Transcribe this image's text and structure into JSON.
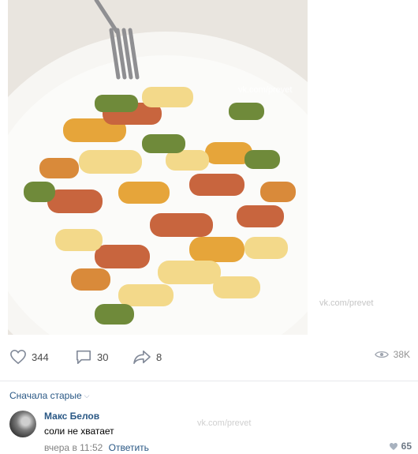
{
  "post": {
    "watermark": "vk.com/prevet",
    "watermark2": "vk.com/prevet"
  },
  "actions": {
    "likes": "344",
    "comments": "30",
    "shares": "8",
    "views": "38K"
  },
  "comments_sort": {
    "label": "Сначала старые"
  },
  "comment": {
    "author": "Макс Белов",
    "text": "соли не хватает",
    "time": "вчера в 11:52",
    "reply_label": "Ответить",
    "likes": "65",
    "watermark": "vk.com/prevet"
  },
  "icons": {
    "like": "heart-outline-icon",
    "comment": "comment-bubble-icon",
    "share": "share-arrow-icon",
    "views": "eye-icon",
    "comment_like": "heart-filled-icon",
    "sort": "chevron-down-icon"
  },
  "colors": {
    "link": "#2a5885",
    "muted": "#828282",
    "pasta_yellow": "#f3d98a",
    "pasta_orange": "#e6a53a",
    "pasta_red": "#c8653e",
    "pasta_green": "#6f8a3a",
    "plate": "#f7f6f3"
  }
}
